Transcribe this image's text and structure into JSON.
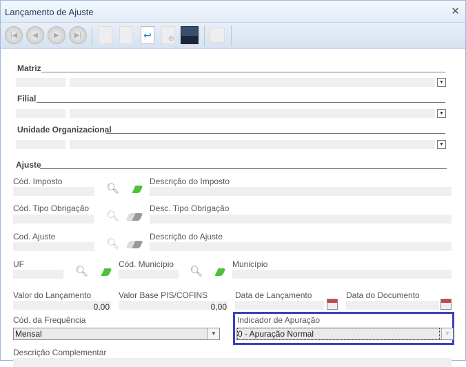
{
  "window": {
    "title": "Lançamento de Ajuste",
    "close": "✕"
  },
  "sections": {
    "matriz": "Matriz",
    "filial": "Filial",
    "unidade": "Unidade Organizacional",
    "ajuste": "Ajuste"
  },
  "fields": {
    "cod_imposto": "Cód. Imposto",
    "desc_imposto": "Descrição do Imposto",
    "cod_tipo_obrigacao": "Cód. Tipo Obrigação",
    "desc_tipo_obrigacao": "Desc. Tipo Obrigação",
    "cod_ajuste": "Cod. Ajuste",
    "desc_ajuste": "Descrição do Ajuste",
    "uf": "UF",
    "cod_municipio": "Cód. Município",
    "municipio": "Município",
    "valor_lancamento": "Valor do Lançamento",
    "valor_lancamento_value": "0,00",
    "valor_base": "Valor Base PIS/COFINS",
    "valor_base_value": "0,00",
    "data_lancamento": "Data de Lançamento",
    "data_documento": "Data do Documento",
    "cod_frequencia": "Cód. da Frequência",
    "cod_frequencia_value": "Mensal",
    "indicador_apuracao": "Indicador de Apuração",
    "indicador_apuracao_value": "0 - Apuração Normal",
    "descricao_complementar": "Descrição Complementar"
  },
  "colors": {
    "highlight": "#3a3fc0",
    "eraser_active": "#4fbf3c"
  }
}
